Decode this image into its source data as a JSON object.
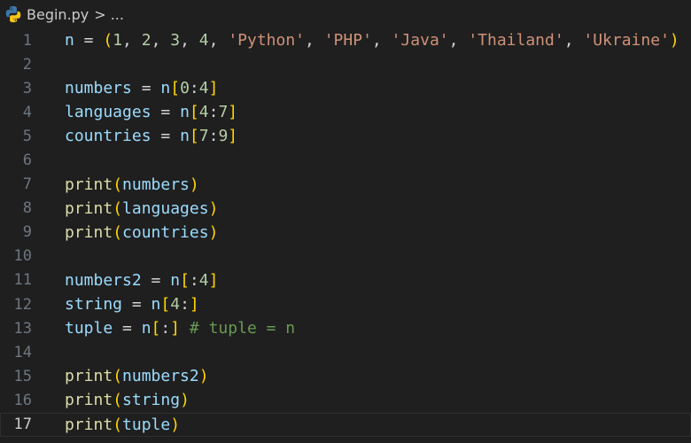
{
  "breadcrumb": {
    "file_name": "Begin.py",
    "separator": ">",
    "more": "..."
  },
  "lines": [
    {
      "num": "1",
      "tokens": [
        {
          "t": "n",
          "c": "v"
        },
        {
          "t": " = ",
          "c": "op"
        },
        {
          "t": "(",
          "c": "b1"
        },
        {
          "t": "1",
          "c": "n"
        },
        {
          "t": ", ",
          "c": "op"
        },
        {
          "t": "2",
          "c": "n"
        },
        {
          "t": ", ",
          "c": "op"
        },
        {
          "t": "3",
          "c": "n"
        },
        {
          "t": ", ",
          "c": "op"
        },
        {
          "t": "4",
          "c": "n"
        },
        {
          "t": ", ",
          "c": "op"
        },
        {
          "t": "'Python'",
          "c": "s"
        },
        {
          "t": ", ",
          "c": "op"
        },
        {
          "t": "'PHP'",
          "c": "s"
        },
        {
          "t": ", ",
          "c": "op"
        },
        {
          "t": "'Java'",
          "c": "s"
        },
        {
          "t": ", ",
          "c": "op"
        },
        {
          "t": "'Thailand'",
          "c": "s"
        },
        {
          "t": ", ",
          "c": "op"
        },
        {
          "t": "'Ukraine'",
          "c": "s"
        },
        {
          "t": ")",
          "c": "b1"
        }
      ]
    },
    {
      "num": "2",
      "tokens": []
    },
    {
      "num": "3",
      "tokens": [
        {
          "t": "numbers",
          "c": "v"
        },
        {
          "t": " = ",
          "c": "op"
        },
        {
          "t": "n",
          "c": "v"
        },
        {
          "t": "[",
          "c": "b1"
        },
        {
          "t": "0",
          "c": "n"
        },
        {
          "t": ":",
          "c": "op"
        },
        {
          "t": "4",
          "c": "n"
        },
        {
          "t": "]",
          "c": "b1"
        }
      ]
    },
    {
      "num": "4",
      "tokens": [
        {
          "t": "languages",
          "c": "v"
        },
        {
          "t": " = ",
          "c": "op"
        },
        {
          "t": "n",
          "c": "v"
        },
        {
          "t": "[",
          "c": "b1"
        },
        {
          "t": "4",
          "c": "n"
        },
        {
          "t": ":",
          "c": "op"
        },
        {
          "t": "7",
          "c": "n"
        },
        {
          "t": "]",
          "c": "b1"
        }
      ]
    },
    {
      "num": "5",
      "tokens": [
        {
          "t": "countries",
          "c": "v"
        },
        {
          "t": " = ",
          "c": "op"
        },
        {
          "t": "n",
          "c": "v"
        },
        {
          "t": "[",
          "c": "b1"
        },
        {
          "t": "7",
          "c": "n"
        },
        {
          "t": ":",
          "c": "op"
        },
        {
          "t": "9",
          "c": "n"
        },
        {
          "t": "]",
          "c": "b1"
        }
      ]
    },
    {
      "num": "6",
      "tokens": []
    },
    {
      "num": "7",
      "tokens": [
        {
          "t": "print",
          "c": "f"
        },
        {
          "t": "(",
          "c": "b1"
        },
        {
          "t": "numbers",
          "c": "v"
        },
        {
          "t": ")",
          "c": "b1"
        }
      ]
    },
    {
      "num": "8",
      "tokens": [
        {
          "t": "print",
          "c": "f"
        },
        {
          "t": "(",
          "c": "b1"
        },
        {
          "t": "languages",
          "c": "v"
        },
        {
          "t": ")",
          "c": "b1"
        }
      ]
    },
    {
      "num": "9",
      "tokens": [
        {
          "t": "print",
          "c": "f"
        },
        {
          "t": "(",
          "c": "b1"
        },
        {
          "t": "countries",
          "c": "v"
        },
        {
          "t": ")",
          "c": "b1"
        }
      ]
    },
    {
      "num": "10",
      "tokens": []
    },
    {
      "num": "11",
      "tokens": [
        {
          "t": "numbers2",
          "c": "v"
        },
        {
          "t": " = ",
          "c": "op"
        },
        {
          "t": "n",
          "c": "v"
        },
        {
          "t": "[",
          "c": "b1"
        },
        {
          "t": ":",
          "c": "op"
        },
        {
          "t": "4",
          "c": "n"
        },
        {
          "t": "]",
          "c": "b1"
        }
      ]
    },
    {
      "num": "12",
      "tokens": [
        {
          "t": "string",
          "c": "v"
        },
        {
          "t": " = ",
          "c": "op"
        },
        {
          "t": "n",
          "c": "v"
        },
        {
          "t": "[",
          "c": "b1"
        },
        {
          "t": "4",
          "c": "n"
        },
        {
          "t": ":",
          "c": "op"
        },
        {
          "t": "]",
          "c": "b1"
        }
      ]
    },
    {
      "num": "13",
      "tokens": [
        {
          "t": "tuple",
          "c": "v"
        },
        {
          "t": " = ",
          "c": "op"
        },
        {
          "t": "n",
          "c": "v"
        },
        {
          "t": "[",
          "c": "b1"
        },
        {
          "t": ":",
          "c": "op"
        },
        {
          "t": "]",
          "c": "b1"
        },
        {
          "t": " ",
          "c": "op"
        },
        {
          "t": "# tuple = n",
          "c": "c"
        }
      ]
    },
    {
      "num": "14",
      "tokens": []
    },
    {
      "num": "15",
      "tokens": [
        {
          "t": "print",
          "c": "f"
        },
        {
          "t": "(",
          "c": "b1"
        },
        {
          "t": "numbers2",
          "c": "v"
        },
        {
          "t": ")",
          "c": "b1"
        }
      ]
    },
    {
      "num": "16",
      "tokens": [
        {
          "t": "print",
          "c": "f"
        },
        {
          "t": "(",
          "c": "b1"
        },
        {
          "t": "string",
          "c": "v"
        },
        {
          "t": ")",
          "c": "b1"
        }
      ]
    },
    {
      "num": "17",
      "tokens": [
        {
          "t": "print",
          "c": "f"
        },
        {
          "t": "(",
          "c": "b1"
        },
        {
          "t": "tuple",
          "c": "v"
        },
        {
          "t": ")",
          "c": "b1"
        }
      ],
      "current": true
    }
  ],
  "colors": {
    "background": "#1f1f1f",
    "variable": "#9cdcfe",
    "number": "#b5cea8",
    "string": "#ce9178",
    "function": "#dcdcaa",
    "bracket": "#ffd700",
    "comment": "#6a9955",
    "line_number": "#6e7681",
    "line_number_active": "#cccccc"
  },
  "icons": {
    "file_icon": "python-icon",
    "breadcrumb_separator": "chevron-right-icon"
  }
}
